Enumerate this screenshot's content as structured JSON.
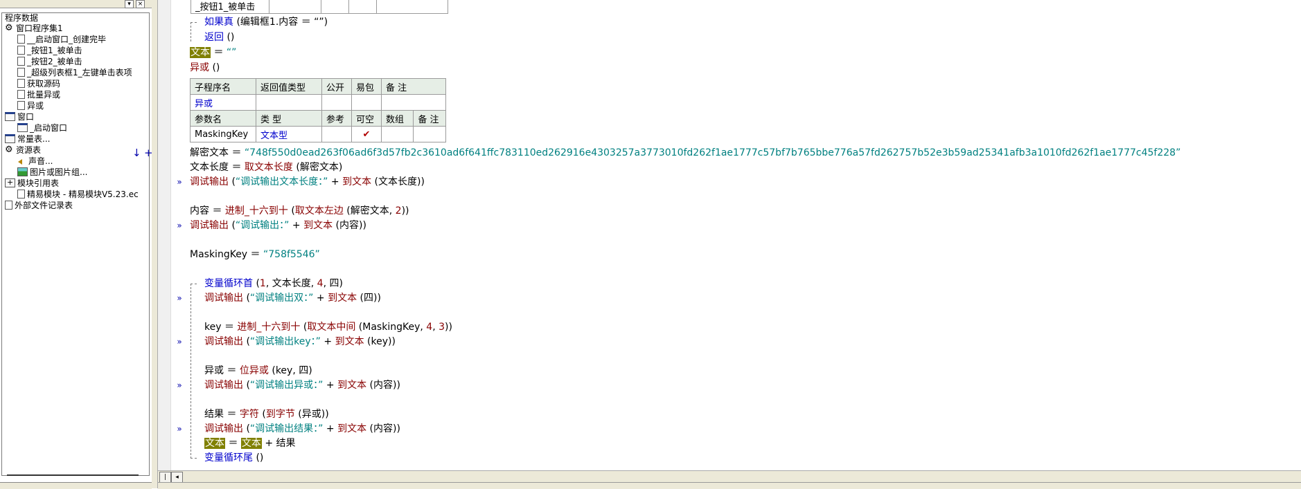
{
  "tree": {
    "items": [
      {
        "label": "程序数据",
        "icon": "none"
      },
      {
        "label": "窗口程序集1",
        "icon": "gear"
      },
      {
        "label": "__启动窗口_创建完毕",
        "icon": "doc"
      },
      {
        "label": "_按钮1_被单击",
        "icon": "doc"
      },
      {
        "label": "_按钮2_被单击",
        "icon": "doc"
      },
      {
        "label": "_超级列表框1_左键单击表项",
        "icon": "doc"
      },
      {
        "label": "获取源码",
        "icon": "doc"
      },
      {
        "label": "批量异或",
        "icon": "doc"
      },
      {
        "label": "异或",
        "icon": "doc"
      },
      {
        "label": "窗口",
        "icon": "window"
      },
      {
        "label": "_启动窗口",
        "icon": "window"
      },
      {
        "label": "常量表...",
        "icon": "table"
      },
      {
        "label": "资源表",
        "icon": "gear"
      },
      {
        "label": "声音...",
        "icon": "sound"
      },
      {
        "label": "图片或图片组...",
        "icon": "picture"
      },
      {
        "label": "模块引用表",
        "icon": "plus"
      },
      {
        "label": "精易模块 - 精易模块V5.23.ec",
        "icon": "doc"
      },
      {
        "label": "外部文件记录表",
        "icon": "doc"
      }
    ]
  },
  "code": {
    "top_row_label": "_按钮1_被单击",
    "if_keyword": "如果真",
    "if_cond": "(编辑框1.内容 ＝ “”)",
    "return_kw": "返回",
    "return_args": "()",
    "var_text": "文本",
    "eq": "＝",
    "empty_str": "“”",
    "call_xor": "异或",
    "call_xor_args": "()",
    "sub_table": {
      "headers": [
        "子程序名",
        "返回值类型",
        "公开",
        "易包",
        "备 注"
      ],
      "name": "异或"
    },
    "param_table": {
      "headers": [
        "参数名",
        "类 型",
        "参考",
        "可空",
        "数组",
        "备 注"
      ],
      "name": "MaskingKey",
      "type": "文本型",
      "nullable_mark": "✔"
    },
    "decrypt_var": "解密文本",
    "decrypt_str": "“748f550d0ead263f06ad6f3d57fb2c3610ad6f641ffc783110ed262916e4303257a3773010fd262f1ae1777c57bf7b765bbe776a57fd262757b52e3b59ad25341afb3a1010fd262f1ae1777c45f228”",
    "len_var": "文本长度",
    "len_fn": "取文本长度",
    "len_arg": "(解密文本)",
    "debug": "调试输出",
    "to_text": "到文本",
    "debug1_str": "“调试输出文本长度：”",
    "debug1_arg": "(文本长度))",
    "content_var": "内容",
    "hex_fn": "进制_十六到十",
    "left_fn": "取文本左边",
    "left_args_a": "(解密文本,",
    "left_num": "2",
    "debug2_str": "“调试输出：”",
    "debug2_arg": "(内容))",
    "mk_var": "MaskingKey",
    "mk_str": "“758f5546”",
    "loop_head": "变量循环首",
    "loop_args_a": "(",
    "loop_n1": "1",
    "loop_len": "文本长度,",
    "loop_n4": "4",
    "loop_var": "四)",
    "debug3_str": "“调试输出双：”",
    "debug3_arg": "(四))",
    "key_var": "key",
    "mid_fn": "取文本中间",
    "mid_args": "(MaskingKey,",
    "mid_n4": "4",
    "mid_n3": "3",
    "debug4_str": "“调试输出key：”",
    "debug4_arg": "(key))",
    "xor_var": "异或",
    "bitxor_fn": "位异或",
    "bitxor_args": "(key, 四)",
    "debug5_str": "“调试输出异或：”",
    "debug5_arg": "(内容))",
    "result_var": "结果",
    "char_fn": "字符",
    "tobyte_fn": "到字节",
    "tobyte_args": "(异或))",
    "debug6_str": "“调试输出结果：”",
    "debug6_arg": "(内容))",
    "plus": "+",
    "loop_tail": "变量循环尾",
    "loop_tail_args": "()"
  }
}
